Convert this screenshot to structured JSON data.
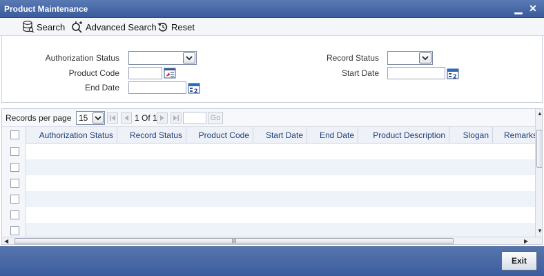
{
  "window": {
    "title": "Product Maintenance",
    "minimize_glyph": "▁",
    "close_glyph": "✕"
  },
  "toolbar": {
    "search_label": "Search",
    "advanced_search_label": "Advanced Search",
    "reset_label": "Reset",
    "icons": [
      "database-search-icon",
      "advanced-search-icon",
      "reset-icon"
    ]
  },
  "search_form": {
    "authorization_status_label": "Authorization Status",
    "authorization_status_value": "",
    "product_code_label": "Product Code",
    "product_code_value": "",
    "end_date_label": "End Date",
    "end_date_value": "",
    "record_status_label": "Record Status",
    "record_status_value": "",
    "start_date_label": "Start Date",
    "start_date_value": ""
  },
  "pager": {
    "records_per_page_label": "Records per page",
    "records_per_page_value": "15",
    "page_info": "1 Of 1",
    "page_input_value": "",
    "go_label": "Go"
  },
  "grid": {
    "columns": [
      "Authorization Status",
      "Record Status",
      "Product Code",
      "Start Date",
      "End Date",
      "Product Description",
      "Slogan",
      "Remarks"
    ],
    "rows": [
      [],
      [],
      [],
      [],
      [],
      []
    ],
    "hscroll_grip": "III"
  },
  "footer": {
    "exit_label": "Exit"
  },
  "colors": {
    "title_bar": "#3a5c9c",
    "header_text": "#1f3f7a",
    "alt_row": "#eef2f9"
  }
}
